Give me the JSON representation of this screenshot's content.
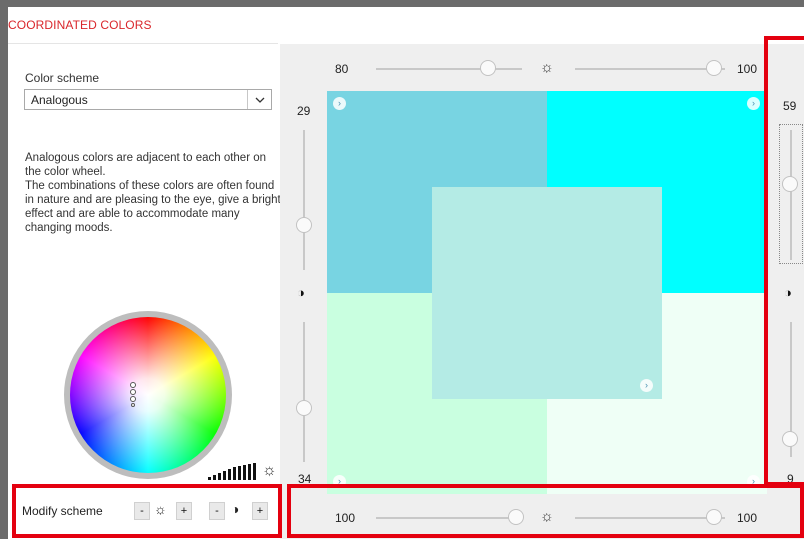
{
  "header": {
    "title": "COORDINATED COLORS"
  },
  "left_panel": {
    "scheme_label": "Color scheme",
    "scheme_value": "Analogous",
    "description": [
      "Analogous colors are adjacent to each other on the color wheel.",
      "The combinations of these colors are often found in nature and are pleasing to the eye, give a bright effect and are able to accommodate many changing moods."
    ],
    "modify": {
      "label": "Modify scheme",
      "minus": "-",
      "plus": "+"
    }
  },
  "sliders": {
    "top_left_value": "80",
    "top_right_value": "100",
    "bottom_left_value": "100",
    "bottom_right_value": "100",
    "left_top_value": "29",
    "left_bottom_value": "34",
    "right_top_value": "59",
    "right_bottom_value": "9"
  },
  "swatches": {
    "top_left": "#78d4e2",
    "top_right": "#00ffff",
    "bottom_left": "#c9ffe0",
    "bottom_right": "#effff6",
    "center": "#b4ebe5"
  },
  "icons": {
    "brightness": "sun-icon",
    "contrast": "contrast-icon",
    "expand": "chevron-right-icon",
    "dropdown": "chevron-down-icon"
  },
  "highlight_color": "#e4000f"
}
